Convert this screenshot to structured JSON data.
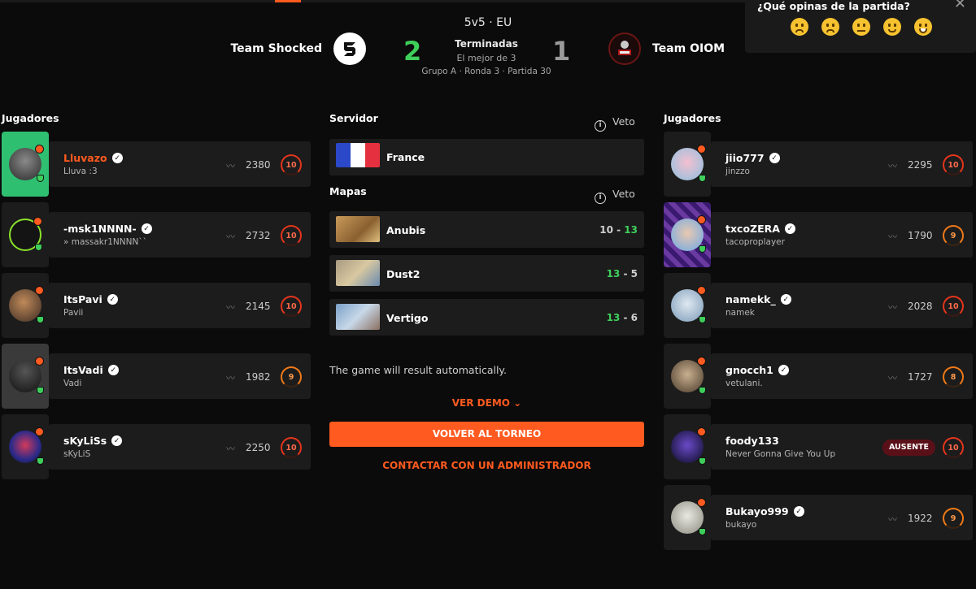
{
  "match": {
    "format": "5v5 · EU",
    "status": "Terminadas",
    "best_of": "El mejor de 3",
    "round_info": "Grupo A · Ronda 3 · Partida 30"
  },
  "teams": {
    "left": {
      "name": "Team Shocked",
      "score": "2"
    },
    "right": {
      "name": "Team OIOM",
      "score": "1"
    }
  },
  "feedback": {
    "question": "¿Qué opinas de la partida?",
    "options": [
      "very-bad-face-icon",
      "sad-face-icon",
      "neutral-face-icon",
      "smile-face-icon",
      "grin-face-icon"
    ]
  },
  "labels": {
    "players": "Jugadores",
    "server": "Servidor",
    "maps": "Mapas",
    "veto": "Veto",
    "auto_result": "The game will result automatically.",
    "ver_demo": "VER DEMO",
    "back": "VOLVER AL TORNEO",
    "contact": "CONTACTAR CON UN ADMINISTRADOR",
    "absent": "AUSENTE"
  },
  "server": {
    "name": "France",
    "flag_colors": [
      "#2b48c8",
      "#ffffff",
      "#e5313f"
    ]
  },
  "maps": [
    {
      "name": "Anubis",
      "score_a": "10",
      "score_b": "13",
      "a_color": "#cfcfcf",
      "b_color": "#3ecf5b"
    },
    {
      "name": "Dust2",
      "score_a": "13",
      "score_b": "5",
      "a_color": "#3ecf5b",
      "b_color": "#cfcfcf"
    },
    {
      "name": "Vertigo",
      "score_a": "13",
      "score_b": "6",
      "a_color": "#3ecf5b",
      "b_color": "#cfcfcf"
    }
  ],
  "left_players": [
    {
      "name": "Lluvazo",
      "sub": "Lluva :3",
      "elo": "2380",
      "level": "10"
    },
    {
      "name": "-msk1NNNN-",
      "sub": "» massakr1NNNN``",
      "elo": "2732",
      "level": "10"
    },
    {
      "name": "ItsPavi",
      "sub": "Pavii",
      "elo": "2145",
      "level": "10"
    },
    {
      "name": "ItsVadi",
      "sub": "Vadi",
      "elo": "1982",
      "level": "9"
    },
    {
      "name": "sKyLiSs",
      "sub": "sKyLiS",
      "elo": "2250",
      "level": "10"
    }
  ],
  "right_players": [
    {
      "name": "jiio777",
      "sub": "jinzzo",
      "elo": "2295",
      "level": "10"
    },
    {
      "name": "txcoZERA",
      "sub": "tacoproplayer",
      "elo": "1790",
      "level": "9"
    },
    {
      "name": "namekk_",
      "sub": "namek",
      "elo": "2028",
      "level": "10"
    },
    {
      "name": "gnocch1",
      "sub": "vetulani.",
      "elo": "1727",
      "level": "8"
    },
    {
      "name": "foody133",
      "sub": "Never Gonna Give You Up",
      "elo": "",
      "level": "10"
    },
    {
      "name": "Bukayo999",
      "sub": "bukayo",
      "elo": "1922",
      "level": "9"
    }
  ],
  "colors": {
    "accent": "#ff5a1f",
    "win": "#3ecf5b",
    "panel": "#1c1c1c"
  }
}
